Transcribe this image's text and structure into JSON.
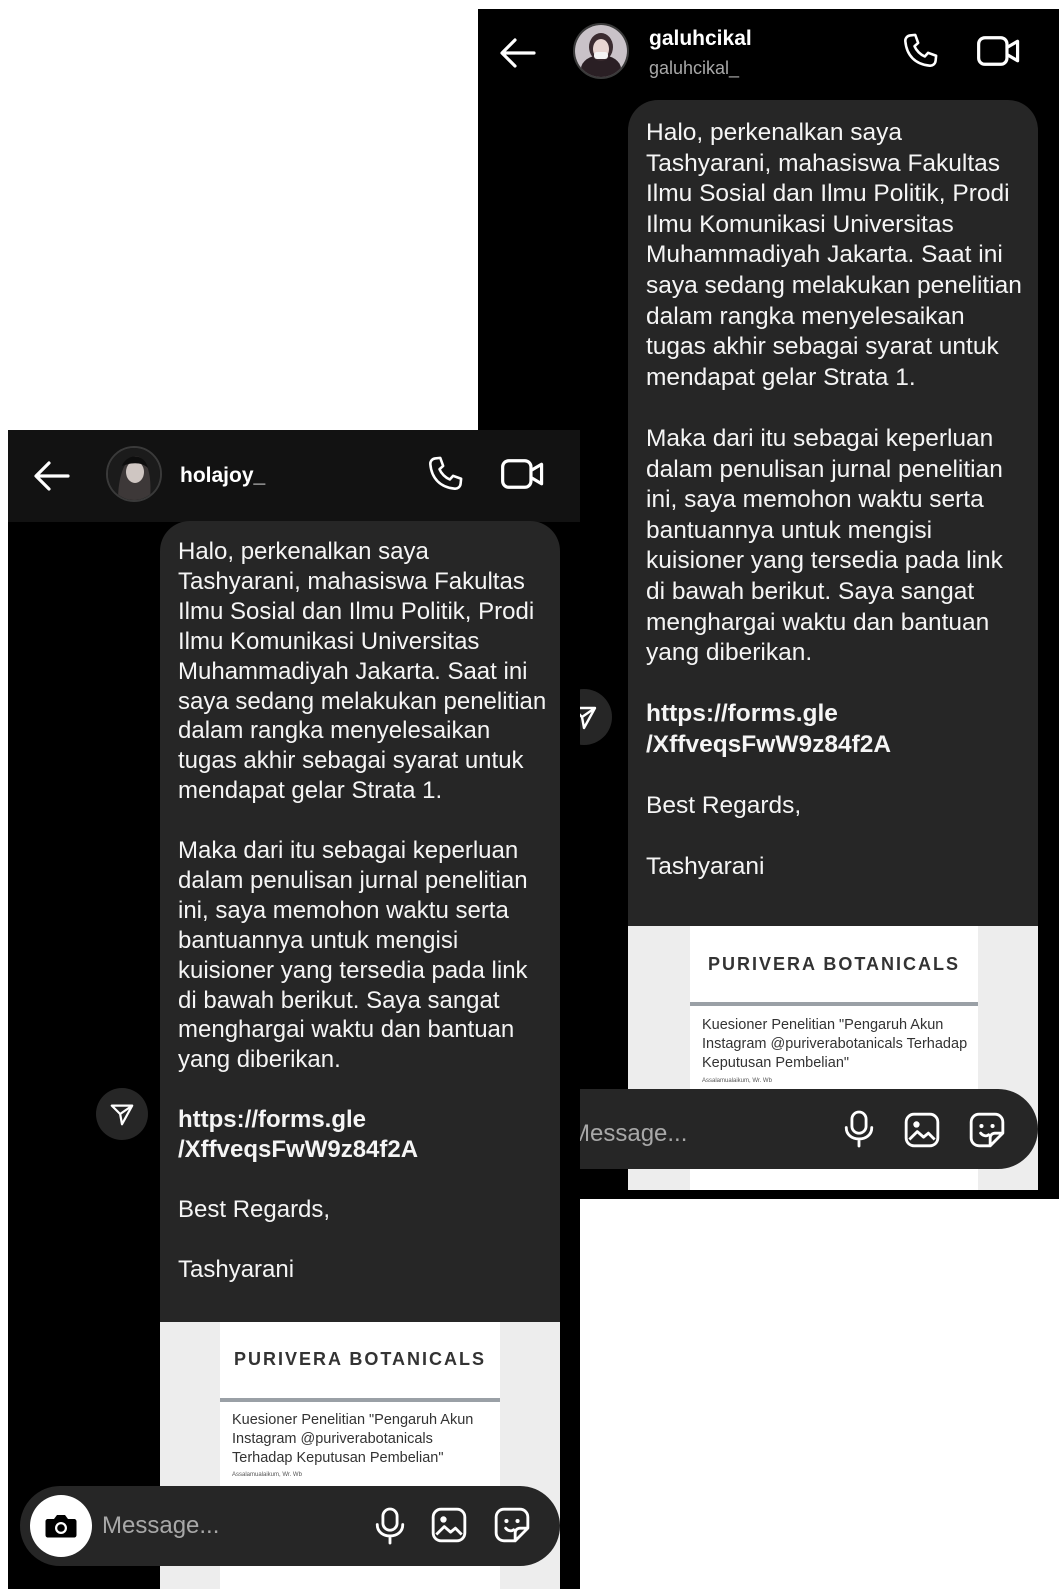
{
  "right_chat": {
    "username": "galuhcikal",
    "handle": "galuhcikal_",
    "message_paragraphs": [
      "Halo, perkenalkan saya Tashyarani, mahasiswa Fakultas Ilmu Sosial dan Ilmu Politik, Prodi Ilmu Komunikasi Universitas Muhammadiyah Jakarta. Saat ini saya sedang melakukan penelitian dalam rangka menyelesaikan tugas akhir sebagai syarat untuk mendapat gelar Strata 1.",
      "Maka dari itu sebagai keperluan dalam penulisan jurnal penelitian ini, saya memohon waktu serta bantuannya untuk mengisi kuisioner yang tersedia pada link di bawah berikut. Saya sangat menghargai waktu dan bantuan yang diberikan."
    ],
    "link_line1": "https://forms.gle",
    "link_line2": "/XffveqsFwW9z84f2A",
    "closing": "Best Regards,",
    "signature": "Tashyarani",
    "preview_brand": "PURIVERA BOTANICALS",
    "preview_title": "Kuesioner Penelitian \"Pengaruh Akun Instagram @puriverabotanicals Terhadap Keputusan Pembelian\"",
    "preview_small": "Assalamualaikum, Wr. Wb",
    "composer_placeholder": "Message..."
  },
  "left_chat": {
    "username": "holajoy_",
    "message_paragraphs": [
      "Halo, perkenalkan saya Tashyarani, mahasiswa Fakultas Ilmu Sosial dan Ilmu Politik, Prodi Ilmu Komunikasi Universitas Muhammadiyah Jakarta. Saat ini saya sedang melakukan penelitian dalam rangka menyelesaikan tugas akhir sebagai syarat untuk mendapat gelar Strata 1.",
      "Maka dari itu sebagai keperluan dalam penulisan jurnal penelitian ini, saya memohon waktu serta bantuannya untuk mengisi kuisioner yang tersedia pada link di bawah berikut. Saya sangat menghargai waktu dan bantuan yang diberikan."
    ],
    "link_line1": "https://forms.gle",
    "link_line2": "/XffveqsFwW9z84f2A",
    "closing": "Best Regards,",
    "signature": "Tashyarani",
    "preview_brand": "PURIVERA BOTANICALS",
    "preview_title": "Kuesioner Penelitian \"Pengaruh Akun Instagram @puriverabotanicals Terhadap Keputusan Pembelian\"",
    "preview_small": "Assalamualaikum, Wr. Wb",
    "composer_placeholder": "Message..."
  },
  "icons": [
    "back-arrow-icon",
    "phone-icon",
    "video-call-icon",
    "share-send-icon",
    "camera-icon",
    "microphone-icon",
    "gallery-icon",
    "sticker-icon"
  ],
  "colors": {
    "background": "#000000",
    "bubble": "#262626",
    "text": "#f5f5f5",
    "secondary_text": "#a8a8a8"
  }
}
